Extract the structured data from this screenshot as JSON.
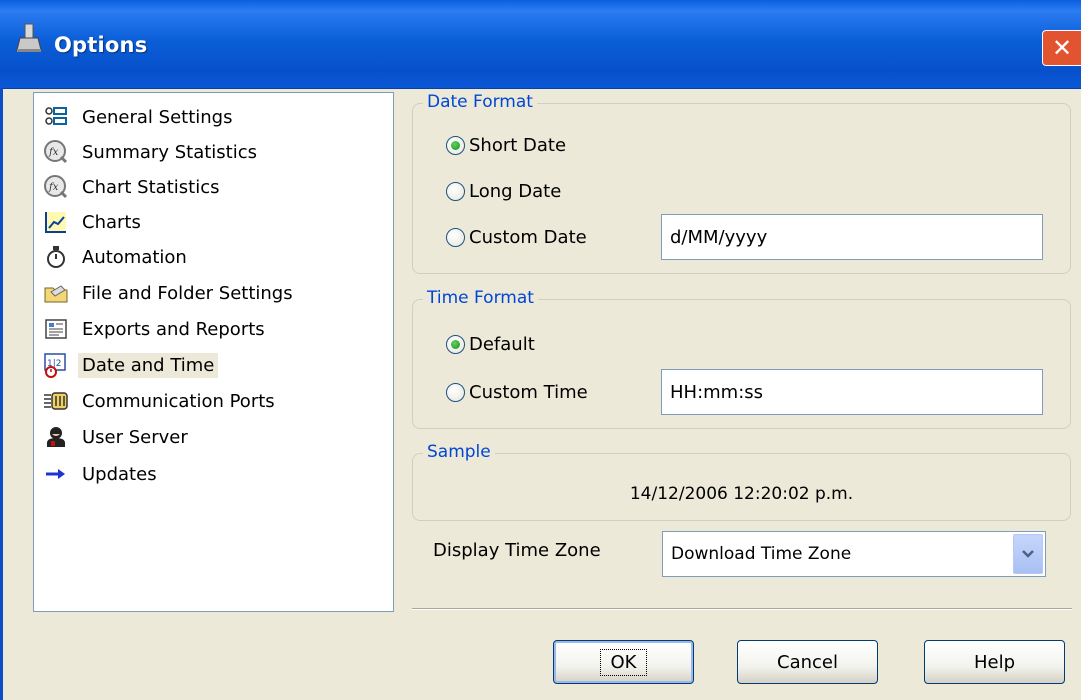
{
  "window": {
    "title": "Options",
    "close_glyph": "✕"
  },
  "tree": {
    "items": [
      {
        "label": "General Settings",
        "icon": "settings-list-icon"
      },
      {
        "label": "Summary Statistics",
        "icon": "function-icon"
      },
      {
        "label": "Chart Statistics",
        "icon": "function-icon"
      },
      {
        "label": "Charts",
        "icon": "line-chart-icon"
      },
      {
        "label": "Automation",
        "icon": "stopwatch-icon"
      },
      {
        "label": "File and Folder Settings",
        "icon": "folder-icon"
      },
      {
        "label": "Exports and Reports",
        "icon": "report-icon"
      },
      {
        "label": "Date and Time",
        "icon": "calendar-clock-icon",
        "selected": true
      },
      {
        "label": "Communication Ports",
        "icon": "serial-port-icon"
      },
      {
        "label": "User Server",
        "icon": "user-icon"
      },
      {
        "label": "Updates",
        "icon": "arrow-right-icon"
      }
    ]
  },
  "date_format": {
    "title": "Date Format",
    "short_date": "Short Date",
    "long_date": "Long Date",
    "custom_date": "Custom Date",
    "custom_date_value": "d/MM/yyyy",
    "selected": "short_date"
  },
  "time_format": {
    "title": "Time Format",
    "default": "Default",
    "custom_time": "Custom Time",
    "custom_time_value": "HH:mm:ss",
    "selected": "default"
  },
  "sample": {
    "title": "Sample",
    "value": "14/12/2006 12:20:02 p.m."
  },
  "time_zone": {
    "label": "Display Time Zone",
    "selected": "Download Time Zone"
  },
  "buttons": {
    "ok": "OK",
    "cancel": "Cancel",
    "help": "Help"
  },
  "colors": {
    "titlebar": "#0a5fe0",
    "group_title": "#0046d5",
    "dialog_bg": "#ece9d8",
    "close": "#e2532f"
  }
}
